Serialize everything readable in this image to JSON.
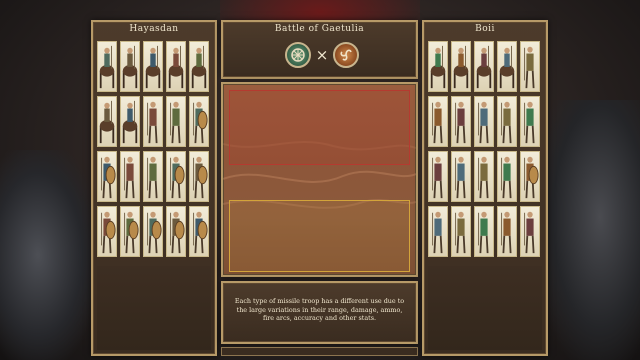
{
  "battle": {
    "title": "Battle of Gaetulia",
    "vs_symbol": "×",
    "left_emblem": "faction-emblem-hayasdan",
    "right_emblem": "faction-emblem-boii"
  },
  "left_army": {
    "name": "Hayasdan",
    "rows": [
      [
        "cavalry",
        "cavalry",
        "cavalry",
        "cavalry",
        "cavalry"
      ],
      [
        "cavalry",
        "cavalry",
        "infantry",
        "infantry",
        "shield-infantry"
      ],
      [
        "shield-infantry",
        "infantry",
        "infantry",
        "shield-infantry",
        "shield-infantry"
      ],
      [
        "shield-infantry",
        "shield-infantry",
        "shield-infantry",
        "shield-infantry",
        "shield-infantry"
      ]
    ]
  },
  "right_army": {
    "name": "Boii",
    "rows": [
      [
        "cavalry",
        "cavalry",
        "cavalry",
        "cavalry",
        "infantry"
      ],
      [
        "infantry",
        "infantry",
        "infantry",
        "infantry",
        "infantry"
      ],
      [
        "infantry",
        "infantry",
        "infantry",
        "infantry",
        "shield-infantry"
      ],
      [
        "infantry",
        "infantry",
        "infantry",
        "infantry",
        "infantry"
      ]
    ]
  },
  "info": {
    "tip": "Each type of missile troop has a different use due to the large variations in their range, damage, ammo, fire arcs, accuracy and other stats."
  },
  "colors": {
    "frame": "#b79a68",
    "panel": "#3a2c20",
    "text": "#efe5cc",
    "deploy_zone_enemy": "#b53a30",
    "deploy_zone_player": "#d3a43a",
    "map": "#8e5639"
  }
}
